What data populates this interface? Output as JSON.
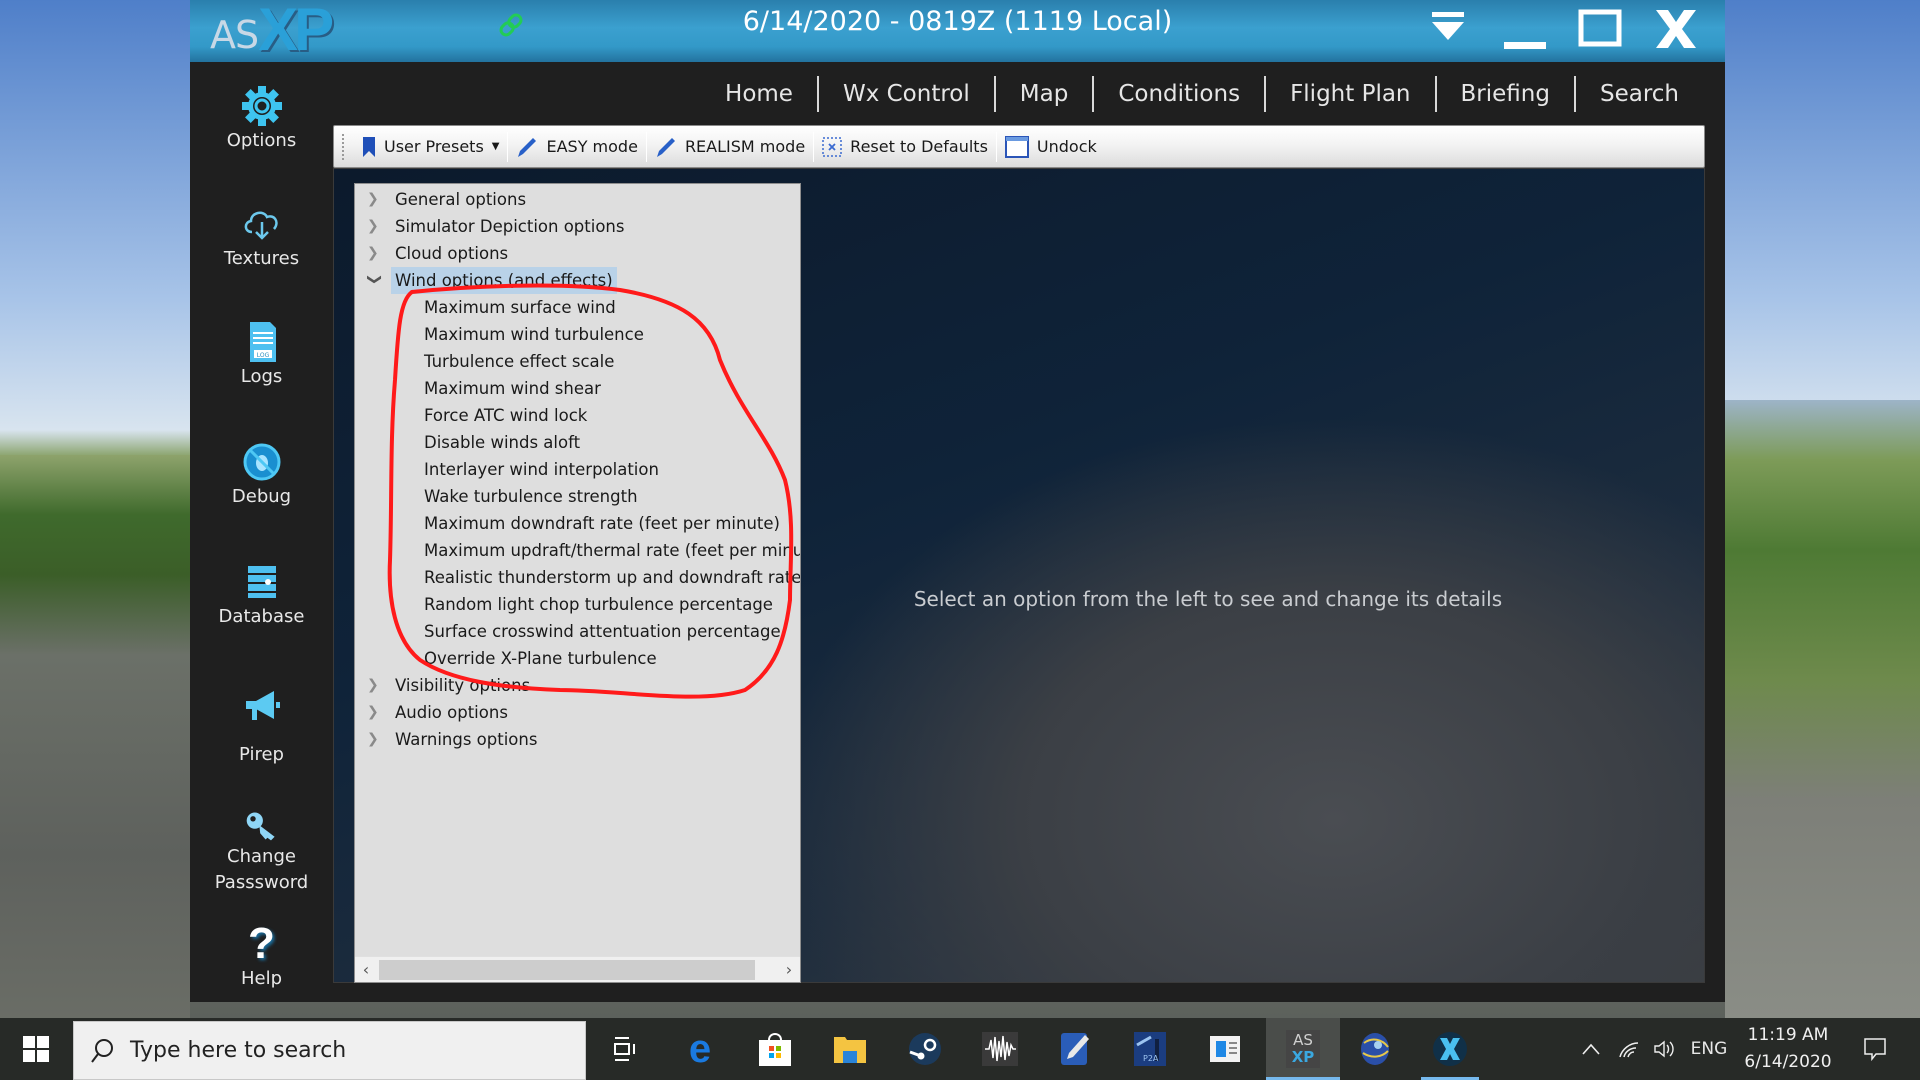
{
  "app": {
    "logo_as": "AS",
    "logo_xp": "XP",
    "title": "6/14/2020 - 0819Z (1119 Local)",
    "window_controls": [
      "menu-dropdown-icon",
      "minimize-icon",
      "maximize-icon",
      "close-icon"
    ],
    "connection_icon": "link-icon",
    "colors": {
      "titlebar": "#3399c8",
      "accent": "#2aa0d8",
      "link_icon": "#22cc55",
      "selected_row": "#b9d2e8",
      "annotation": "#ff0000"
    }
  },
  "nav": {
    "items": [
      "Home",
      "Wx Control",
      "Map",
      "Conditions",
      "Flight Plan",
      "Briefing",
      "Search"
    ]
  },
  "sidebar": {
    "items": [
      {
        "label": "Options",
        "icon": "gear-icon"
      },
      {
        "label": "Textures",
        "icon": "cloud-download-icon"
      },
      {
        "label": "Logs",
        "icon": "log-file-icon"
      },
      {
        "label": "Debug",
        "icon": "debug-bug-icon"
      },
      {
        "label": "Database",
        "icon": "database-icon"
      },
      {
        "label": "Pirep",
        "icon": "megaphone-icon"
      },
      {
        "label": "Change",
        "label2": "Passsword",
        "icon": "key-icon"
      },
      {
        "label": "Help",
        "icon": "help-question-icon"
      }
    ]
  },
  "toolbar": {
    "user_presets": "User Presets",
    "easy_mode": "EASY mode",
    "realism_mode": "REALISM mode",
    "reset_defaults": "Reset to Defaults",
    "undock": "Undock"
  },
  "tree": {
    "top_groups": [
      "General options",
      "Simulator Depiction options",
      "Cloud options"
    ],
    "expanded_group": "Wind options (and effects)",
    "children": [
      "Maximum surface wind",
      "Maximum wind turbulence",
      "Turbulence effect scale",
      "Maximum wind shear",
      "Force ATC wind lock",
      "Disable winds aloft",
      "Interlayer wind interpolation",
      "Wake turbulence strength",
      "Maximum downdraft rate (feet per minute)",
      "Maximum updraft/thermal rate (feet per minute)",
      "Realistic thunderstorm up and downdraft rate",
      "Random light chop turbulence percentage",
      "Surface crosswind attentuation percentage",
      "Override X-Plane turbulence"
    ],
    "bottom_groups": [
      "Visibility options",
      "Audio options",
      "Warnings options"
    ]
  },
  "detail": {
    "placeholder": "Select an option from the left to see and change its details"
  },
  "taskbar": {
    "search_placeholder": "Type here to search",
    "apps": [
      "task-view-icon",
      "edge-icon",
      "store-icon",
      "file-explorer-icon",
      "steam-icon",
      "audio-wave-app-icon",
      "notepad-pen-app-icon",
      "p2a-app-icon",
      "window-app-icon",
      "asxp-app-icon",
      "globe-app-icon",
      "xplane-app-icon"
    ],
    "asxp_label_top": "AS",
    "asxp_label_bottom": "XP",
    "language": "ENG",
    "time": "11:19 AM",
    "date": "6/14/2020"
  }
}
